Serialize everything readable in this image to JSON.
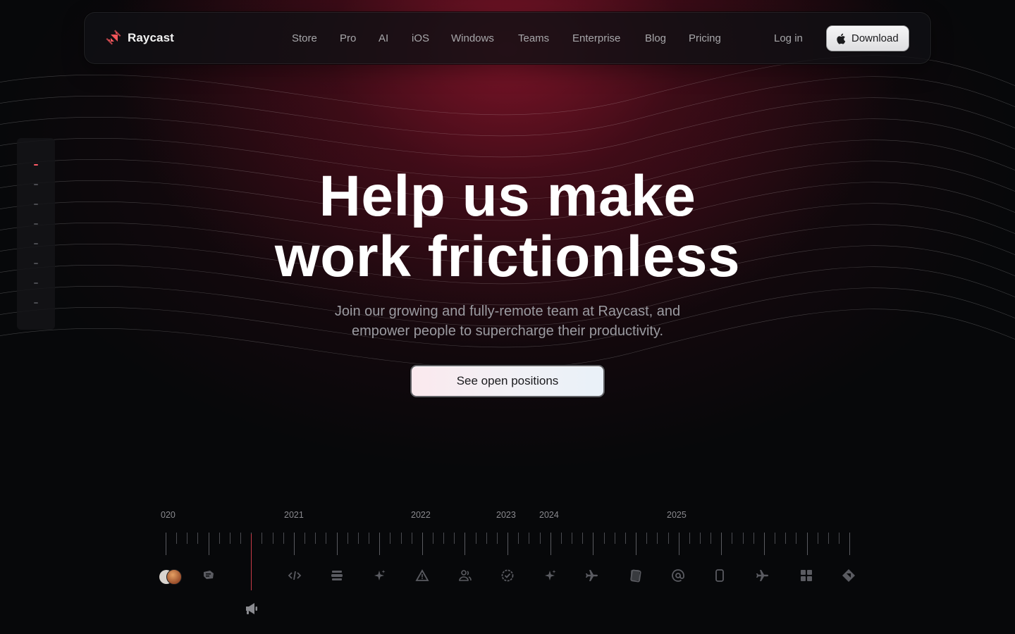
{
  "nav": {
    "brand": "Raycast",
    "links": [
      "Store",
      "Pro",
      "AI",
      "iOS",
      "Windows",
      "Teams",
      "Enterprise",
      "Blog",
      "Pricing"
    ],
    "login": "Log in",
    "download": "Download"
  },
  "hero": {
    "title_line1": "Help us make",
    "title_line2": "work frictionless",
    "subtitle_line1": "Join our growing and fully-remote team at Raycast, and",
    "subtitle_line2": "empower people to supercharge their productivity.",
    "cta": "See open positions"
  },
  "side_nav": {
    "item_count": 8,
    "active_index": 0
  },
  "timeline": {
    "years": [
      "020",
      "2021",
      "2022",
      "2023",
      "2024",
      "2025"
    ],
    "icons": [
      "avatars",
      "chat-icon",
      "code-icon",
      "list-icon",
      "sparkle-icon",
      "warning-icon",
      "people-icon",
      "badge-check-icon",
      "sparkle-icon",
      "plane-icon",
      "cards-icon",
      "at-sign-icon",
      "phone-icon",
      "plane-icon",
      "grid-icon",
      "raycast-logo-icon"
    ],
    "current_marker_icon": "megaphone-icon"
  },
  "colors": {
    "accent": "#ff5a66",
    "background": "#07080a",
    "glow": "#8c162c"
  }
}
